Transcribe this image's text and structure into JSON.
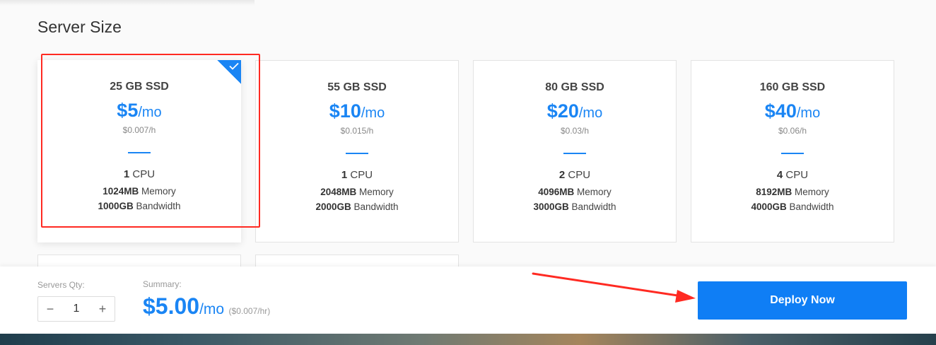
{
  "page": {
    "section_title": "Server Size"
  },
  "plans": [
    {
      "storage": "25 GB SSD",
      "price": "$5",
      "per": "/mo",
      "hourly": "$0.007/h",
      "cpu_count": "1",
      "cpu_label": "CPU",
      "memory": "1024MB",
      "memory_label": "Memory",
      "bandwidth": "1000GB",
      "bandwidth_label": "Bandwidth",
      "selected": true
    },
    {
      "storage": "55 GB SSD",
      "price": "$10",
      "per": "/mo",
      "hourly": "$0.015/h",
      "cpu_count": "1",
      "cpu_label": "CPU",
      "memory": "2048MB",
      "memory_label": "Memory",
      "bandwidth": "2000GB",
      "bandwidth_label": "Bandwidth",
      "selected": false
    },
    {
      "storage": "80 GB SSD",
      "price": "$20",
      "per": "/mo",
      "hourly": "$0.03/h",
      "cpu_count": "2",
      "cpu_label": "CPU",
      "memory": "4096MB",
      "memory_label": "Memory",
      "bandwidth": "3000GB",
      "bandwidth_label": "Bandwidth",
      "selected": false
    },
    {
      "storage": "160 GB SSD",
      "price": "$40",
      "per": "/mo",
      "hourly": "$0.06/h",
      "cpu_count": "4",
      "cpu_label": "CPU",
      "memory": "8192MB",
      "memory_label": "Memory",
      "bandwidth": "4000GB",
      "bandwidth_label": "Bandwidth",
      "selected": false
    }
  ],
  "footer": {
    "qty_label": "Servers Qty:",
    "qty_value": "1",
    "minus": "−",
    "plus": "+",
    "summary_label": "Summary:",
    "summary_amount": "$5.00",
    "summary_per": "/mo",
    "summary_hourly": "($0.007/hr)",
    "deploy_label": "Deploy Now"
  },
  "icons": {
    "selected_badge": "check-icon"
  },
  "colors": {
    "accent": "#1a85f4",
    "button": "#0f7ef5",
    "annotation": "#ff2a22"
  }
}
